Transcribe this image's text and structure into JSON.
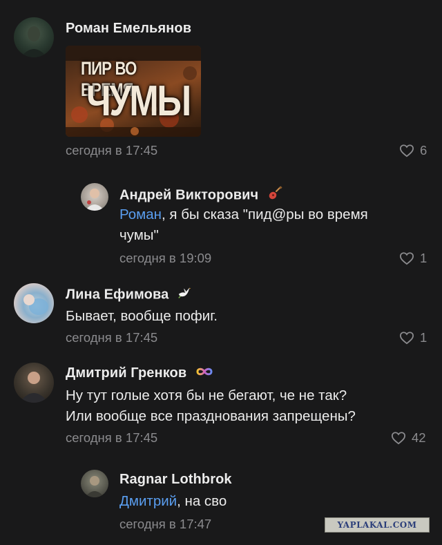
{
  "comments": [
    {
      "author": "Роман Емельянов",
      "image_title_line1": "ПИР ВО ВРЕМЯ",
      "image_title_line2": "ЧУМЫ",
      "time": "сегодня в 17:45",
      "likes": "6"
    },
    {
      "author": "Андрей Викторович",
      "badge": "guitar-icon",
      "mention": "Роман",
      "text_line1": ", я бы сказа \"пид@ры во время",
      "text_line2": "чумы\"",
      "time": "сегодня в 19:09",
      "likes": "1"
    },
    {
      "author": "Лина Ефимова",
      "badge": "dove-icon",
      "text_line1": "Бывает, вообще пофиг.",
      "time": "сегодня в 17:45",
      "likes": "1"
    },
    {
      "author": "Дмитрий Гренков",
      "badge": "infinity-icon",
      "text_line1": "Ну тут голые хотя бы не бегают, че не так?",
      "text_line2": "Или вообще все празднования запрещены?",
      "time": "сегодня в 17:45",
      "likes": "42"
    },
    {
      "author": "Ragnar Lothbrok",
      "mention": "Дмитрий",
      "text_line1": ", на сво",
      "time": "сегодня в 17:47"
    }
  ],
  "watermark": "YAPLAKAL.COM",
  "colors": {
    "background": "#19191a",
    "mention": "#5a9ef0",
    "meta": "#8b8b8e"
  }
}
